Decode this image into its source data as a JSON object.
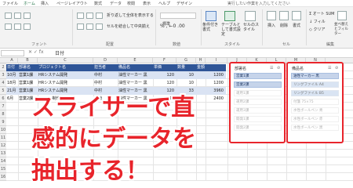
{
  "ribbon": {
    "tabs": [
      "ファイル",
      "ホーム",
      "挿入",
      "ページレイアウト",
      "数式",
      "データ",
      "校閲",
      "表示",
      "ヘルプ",
      "デザイン"
    ],
    "tell_me": "実行したい作業を入力してください",
    "wrap_text": "折り返して全体を表示する",
    "merge_center": "セルを結合して中央揃え",
    "number_format": "標準",
    "conditional_format": "条件付き書式",
    "format_as_table": "テーブルとして書式設定",
    "cell_styles": "セルのスタイル",
    "insert": "挿入",
    "delete": "削除",
    "format": "書式",
    "autosum": "オート SUM",
    "fill": "フィル",
    "clear": "クリア",
    "sort_filter": "並べ替えとフィルター",
    "group_font": "フォント",
    "group_alignment": "配置",
    "group_number": "数値",
    "group_styles": "スタイル",
    "group_cells": "セル",
    "group_editing": "編集"
  },
  "formula_bar": {
    "name_box": "",
    "fx": "✕ ✓ fx",
    "content": "日付"
  },
  "grid": {
    "columns": [
      "A",
      "B",
      "C",
      "D",
      "E",
      "F",
      "G",
      "H",
      "I",
      "J",
      "K",
      "L",
      "M",
      "N"
    ],
    "rows": [
      "2",
      "3",
      "4",
      "5",
      "6",
      "7",
      "8",
      "9",
      "10",
      "11",
      "12",
      "13",
      "14",
      "15",
      "16"
    ]
  },
  "table": {
    "headers": [
      "日付",
      "部署名",
      "プロジェクト名",
      "担当者",
      "備品名",
      "単価",
      "数量",
      "金額"
    ],
    "rows": [
      [
        "10月",
        "営業1課",
        "HRシステム開発",
        "中村",
        "油性マーカー 黒",
        "120",
        "10",
        "1200"
      ],
      [
        "18月",
        "営業1課",
        "HRシステム開発",
        "中村",
        "油性マーカー 黒",
        "120",
        "10",
        "1200"
      ],
      [
        "21月",
        "営業1課",
        "HRシステム開発",
        "中村",
        "油性マーカー 黒",
        "120",
        "33",
        "3960"
      ],
      [
        "6月",
        "営業2課",
        "ECWeb制作",
        "山崎",
        "油性マーカー 黒",
        "120",
        "20",
        "2400"
      ]
    ]
  },
  "slicer_dept": {
    "title": "部署名",
    "items": [
      "営業1課",
      "営業2課",
      "運用1課",
      "運用2課",
      "運用3課",
      "開発1課",
      "開発2課"
    ]
  },
  "slicer_item": {
    "title": "備品名",
    "items": [
      "油性マーカー 黒",
      "リングファイル A4",
      "リングファイル B5",
      "付箋 75×75",
      "水性ボールペン 青",
      "水性ボールペン 赤",
      "水性ボールペン 黒"
    ]
  },
  "caption": {
    "line1": "スライサーで直",
    "line2": "感的にデータを",
    "line3": "抽出する！"
  },
  "colors": {
    "excel_green": "#217346",
    "table_header": "#2f5597",
    "table_band": "#dae3f3",
    "slicer_border": "#e8242b",
    "caption_red": "#e8242b"
  }
}
